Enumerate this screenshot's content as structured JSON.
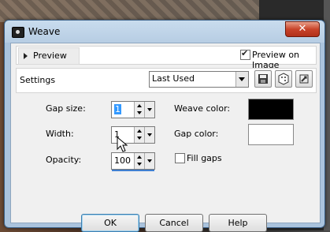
{
  "window": {
    "title": "Weave",
    "close_label": "✕"
  },
  "preview": {
    "toggle_label": "Preview",
    "preview_on_image_label": "Preview on Image",
    "preview_on_image_checked": true
  },
  "settings": {
    "label": "Settings",
    "preset_value": "Last Used"
  },
  "params": {
    "gap_size": {
      "label": "Gap size:",
      "value": "1"
    },
    "width": {
      "label": "Width:",
      "value": "1"
    },
    "opacity": {
      "label": "Opacity:",
      "value": "100"
    },
    "weave_color": {
      "label": "Weave color:",
      "color": "#000000"
    },
    "gap_color": {
      "label": "Gap color:",
      "color": "#ffffff"
    },
    "fill_gaps": {
      "label": "Fill gaps",
      "checked": false
    }
  },
  "buttons": {
    "ok": "OK",
    "cancel": "Cancel",
    "help": "Help"
  },
  "icons": [
    "camera-icon",
    "save-preset-icon",
    "random-icon",
    "reset-icon"
  ]
}
